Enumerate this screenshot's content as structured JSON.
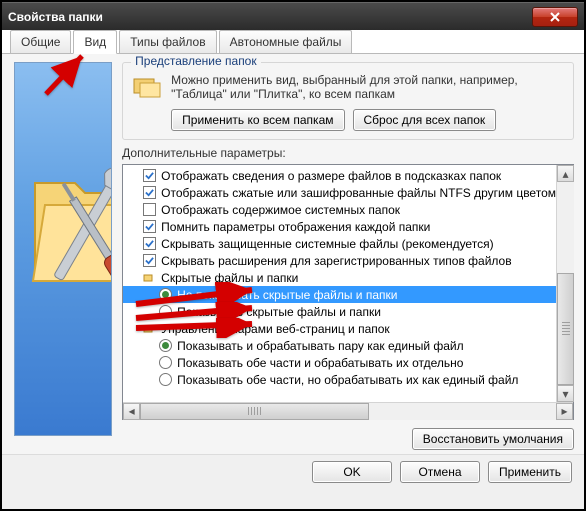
{
  "window": {
    "title": "Свойства папки"
  },
  "tabs": [
    {
      "label": "Общие"
    },
    {
      "label": "Вид"
    },
    {
      "label": "Типы файлов"
    },
    {
      "label": "Автономные файлы"
    }
  ],
  "activeTab": 1,
  "folderViews": {
    "groupTitle": "Представление папок",
    "description": "Можно применить вид, выбранный для этой папки, например, \"Таблица\" или \"Плитка\", ко всем папкам",
    "applyAll": "Применить ко всем папкам",
    "resetAll": "Сброс для всех папок"
  },
  "advanced": {
    "heading": "Дополнительные параметры:",
    "items": [
      {
        "kind": "check",
        "checked": true,
        "indent": 0,
        "label": "Отображать сведения о размере файлов в подсказках папок"
      },
      {
        "kind": "check",
        "checked": true,
        "indent": 0,
        "label": "Отображать сжатые или зашифрованные файлы NTFS другим цветом"
      },
      {
        "kind": "check",
        "checked": false,
        "indent": 0,
        "label": "Отображать содержимое системных папок"
      },
      {
        "kind": "check",
        "checked": true,
        "indent": 0,
        "label": "Помнить параметры отображения каждой папки"
      },
      {
        "kind": "check",
        "checked": true,
        "indent": 0,
        "label": "Скрывать защищенные системные файлы (рекомендуется)"
      },
      {
        "kind": "check",
        "checked": true,
        "indent": 0,
        "label": "Скрывать расширения для зарегистрированных типов файлов"
      },
      {
        "kind": "group",
        "indent": 0,
        "label": "Скрытые файлы и папки"
      },
      {
        "kind": "radio",
        "checked": true,
        "indent": 1,
        "selected": true,
        "label": "Не показывать скрытые файлы и папки"
      },
      {
        "kind": "radio",
        "checked": false,
        "indent": 1,
        "label": "Показывать скрытые файлы и папки"
      },
      {
        "kind": "group",
        "indent": 0,
        "label": "Управление парами веб-страниц и папок"
      },
      {
        "kind": "radio",
        "checked": true,
        "indent": 1,
        "label": "Показывать и обрабатывать пару как единый файл"
      },
      {
        "kind": "radio",
        "checked": false,
        "indent": 1,
        "label": "Показывать обе части и обрабатывать их отдельно"
      },
      {
        "kind": "radio",
        "checked": false,
        "indent": 1,
        "label": "Показывать обе части, но обрабатывать их как единый файл"
      }
    ]
  },
  "restoreDefaults": "Восстановить умолчания",
  "buttons": {
    "ok": "OK",
    "cancel": "Отмена",
    "apply": "Применить"
  }
}
